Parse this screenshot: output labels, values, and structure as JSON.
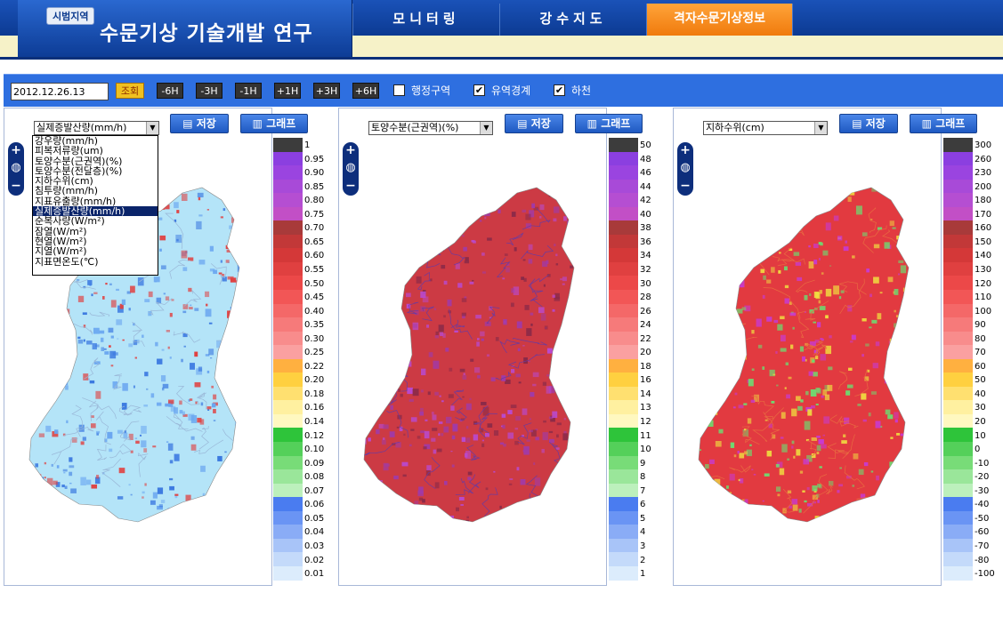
{
  "header": {
    "badge": "시범지역",
    "title": "수문기상 기술개발 연구",
    "nav": [
      {
        "label": "모니터링"
      },
      {
        "label": "강수지도"
      },
      {
        "label": "격자수문기상정보"
      }
    ]
  },
  "toolbar": {
    "date": "2012.12.26.13",
    "query": "조회",
    "steps": [
      "-6H",
      "-3H",
      "-1H",
      "+1H",
      "+3H",
      "+6H"
    ],
    "checks": [
      {
        "label": "행정구역",
        "checked": false,
        "mark": ""
      },
      {
        "label": "유역경계",
        "checked": true,
        "mark": "✔"
      },
      {
        "label": "하천",
        "checked": true,
        "mark": "✔"
      }
    ]
  },
  "panels": [
    {
      "select": "실제증발산량(mm/h)",
      "save": "저장",
      "graph": "그래프",
      "legend": [
        "1",
        "0.95",
        "0.90",
        "0.85",
        "0.80",
        "0.75",
        "0.70",
        "0.65",
        "0.60",
        "0.55",
        "0.50",
        "0.45",
        "0.40",
        "0.35",
        "0.30",
        "0.25",
        "0.22",
        "0.20",
        "0.18",
        "0.16",
        "0.14",
        "0.12",
        "0.10",
        "0.09",
        "0.08",
        "0.07",
        "0.06",
        "0.05",
        "0.04",
        "0.03",
        "0.02",
        "0.01"
      ]
    },
    {
      "select": "토양수분(근권역)(%)",
      "save": "저장",
      "graph": "그래프",
      "legend": [
        "50",
        "48",
        "46",
        "44",
        "42",
        "40",
        "38",
        "36",
        "34",
        "32",
        "30",
        "28",
        "26",
        "24",
        "22",
        "20",
        "18",
        "16",
        "14",
        "13",
        "12",
        "11",
        "10",
        "9",
        "8",
        "7",
        "6",
        "5",
        "4",
        "3",
        "2",
        "1"
      ]
    },
    {
      "select": "지하수위(cm)",
      "save": "저장",
      "graph": "그래프",
      "legend": [
        "300",
        "260",
        "230",
        "200",
        "180",
        "170",
        "160",
        "150",
        "140",
        "130",
        "120",
        "110",
        "100",
        "90",
        "80",
        "70",
        "60",
        "50",
        "40",
        "30",
        "20",
        "10",
        "0",
        "-10",
        "-20",
        "-30",
        "-40",
        "-50",
        "-60",
        "-70",
        "-80",
        "-100"
      ]
    }
  ],
  "dropdown": {
    "options": [
      "강우량(mm/h)",
      "피복저류량(um)",
      "토양수분(근권역)(%)",
      "토양수분(전달층)(%)",
      "지하수위(cm)",
      "침투량(mm/h)",
      "지표유출량(mm/h)",
      "실제증발산량(mm/h)",
      "순복사량(W/m²)",
      "잠열(W/m²)",
      "현열(W/m²)",
      "지열(W/m²)",
      "지표면온도(℃)"
    ],
    "selected_index": 7
  },
  "legend_colors": [
    "#3c3c3c",
    "#8b3fe0",
    "#9a44e0",
    "#a84ad8",
    "#b54ed2",
    "#c24fc6",
    "#a83a3a",
    "#c23838",
    "#d43838",
    "#e04040",
    "#ec4848",
    "#f25656",
    "#f46868",
    "#f67a7a",
    "#f88c8c",
    "#faa0a0",
    "#ffb040",
    "#ffd040",
    "#ffe070",
    "#fff0a0",
    "#fff8c0",
    "#2ec43a",
    "#54d05a",
    "#78dc78",
    "#9ae69a",
    "#bcf0bc",
    "#4a7cf0",
    "#6a94f4",
    "#8aacf6",
    "#a8c4f8",
    "#c4dafa",
    "#dcecfc"
  ]
}
